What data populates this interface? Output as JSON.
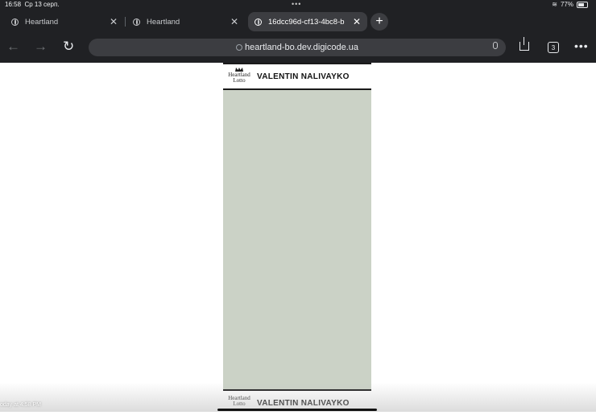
{
  "status_bar": {
    "time": "16:58",
    "date": "Ср 13 серп.",
    "battery": "77%"
  },
  "tabs": [
    {
      "title": "Heartland",
      "active": false
    },
    {
      "title": "Heartland",
      "active": false
    },
    {
      "title": "16dcc96d-cf13-4bc8-b",
      "active": true
    }
  ],
  "toolbar": {
    "url": "heartland-bo.dev.digicode.ua",
    "tab_count": "3"
  },
  "ticket": {
    "logo_line1": "Heartland",
    "logo_line2": "Lotto",
    "player_name": "VALENTIN NALIVAYKO",
    "footer_logo_line1": "Heartland",
    "footer_logo_line2": "Lotto",
    "footer_player_name": "VALENTIN NALIVAYKO",
    "body_color": "#cbd2c6"
  },
  "caption": "oday at 4:58 PM"
}
